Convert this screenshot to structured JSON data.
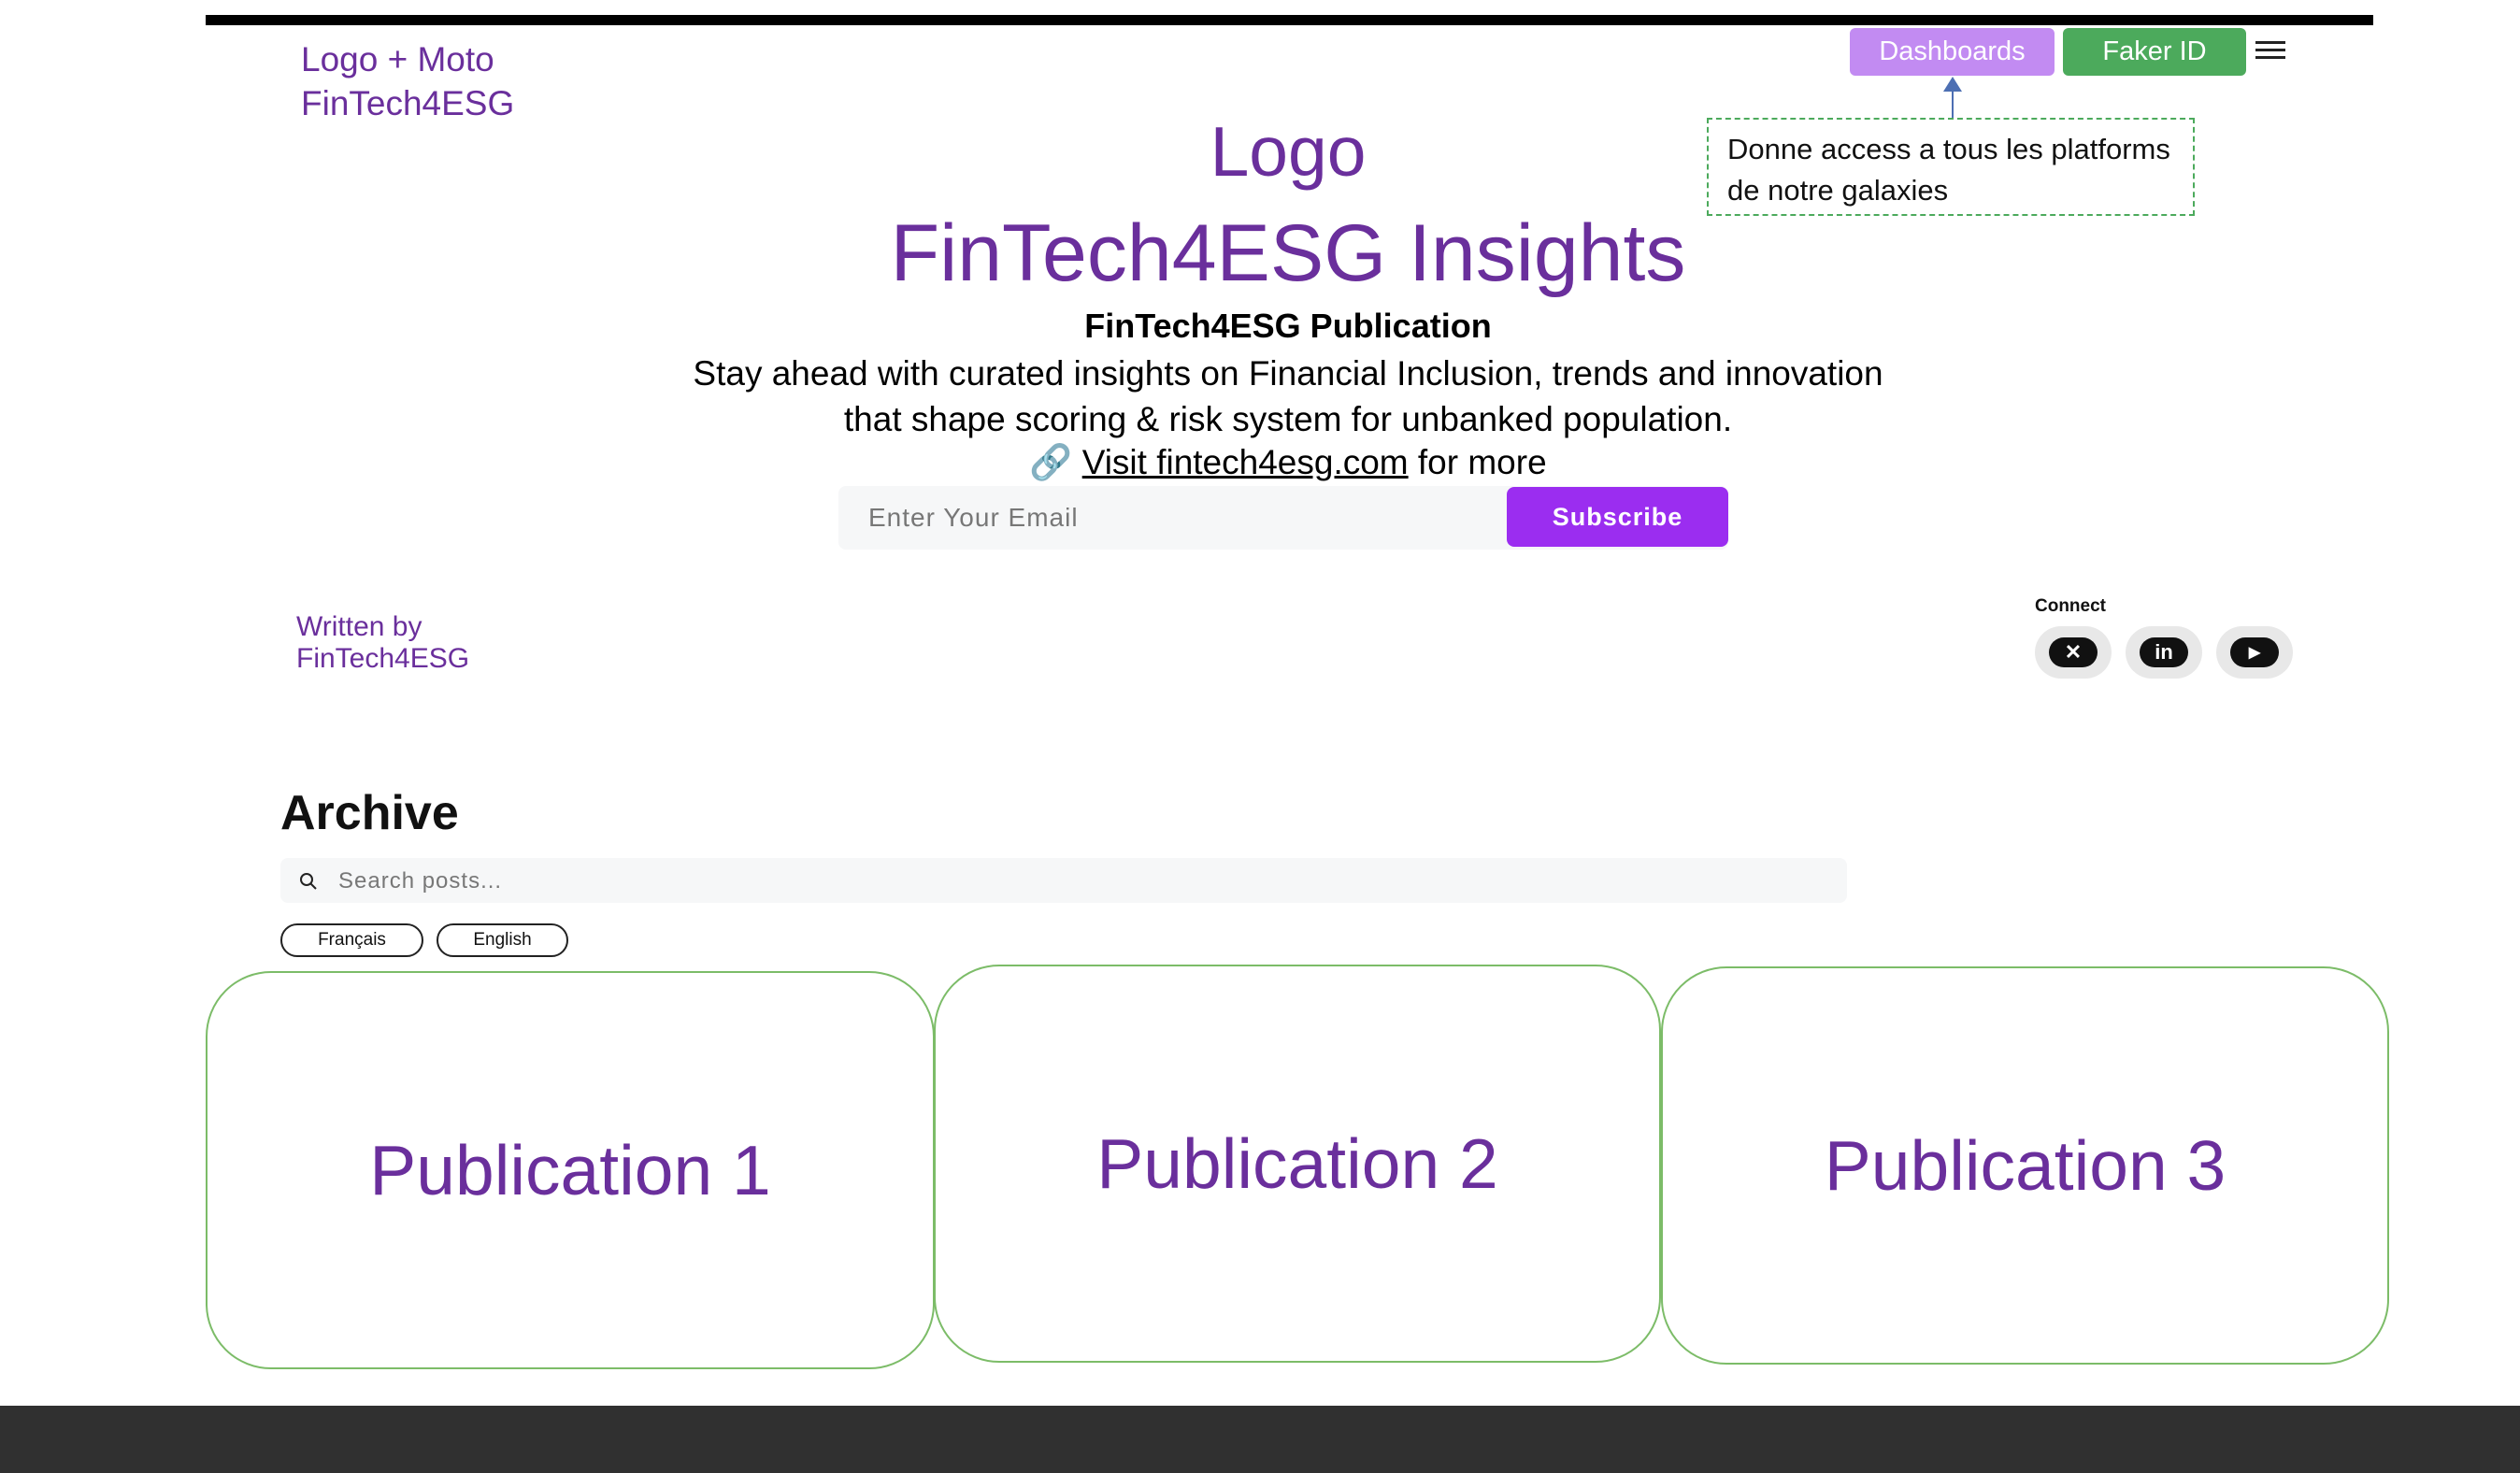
{
  "header": {
    "logo_moto": "Logo + Moto",
    "brand": "FinTech4ESG",
    "dashboards_label": "Dashboards",
    "faker_id_label": "Faker ID",
    "menu_icon": "hamburger-icon",
    "callout_text": "Donne access a tous les platforms de notre galaxies"
  },
  "hero": {
    "logo": "Logo",
    "title": "FinTech4ESG Insights",
    "publication": "FinTech4ESG Publication",
    "tagline_line1": "Stay ahead with curated insights on Financial Inclusion, trends and innovation",
    "tagline_line2": "that shape scoring & risk system for unbanked population.",
    "link_icon": "🔗",
    "visit_link": "Visit fintech4esg.com",
    "visit_suffix": " for more"
  },
  "subscribe": {
    "email_placeholder": "Enter Your Email",
    "button_label": "Subscribe"
  },
  "author": {
    "line1": "Written by",
    "line2": "FinTech4ESG"
  },
  "connect": {
    "label": "Connect",
    "icons": [
      "x-icon",
      "linkedin-icon",
      "youtube-icon"
    ],
    "x_glyph": "✕",
    "linkedin_glyph": "in",
    "youtube_glyph": "▶"
  },
  "archive": {
    "title": "Archive",
    "search_placeholder": "Search posts...",
    "languages": [
      "Français",
      "English"
    ]
  },
  "publications": [
    "Publication 1",
    "Publication 2",
    "Publication 3"
  ],
  "colors": {
    "brand_purple": "#6a2f9c",
    "dashboards": "#c28bf2",
    "faker_id": "#4caa5c",
    "subscribe": "#9b2df0",
    "card_border": "#7cbc68",
    "footer": "#303030"
  }
}
